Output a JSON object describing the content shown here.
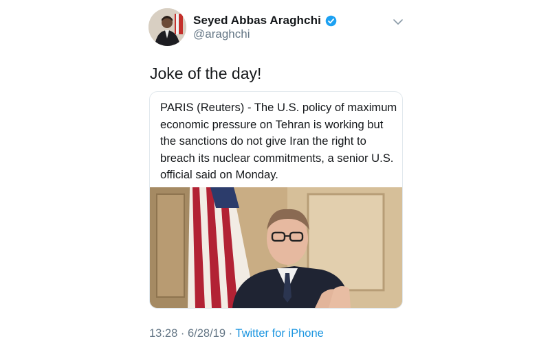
{
  "author": {
    "name": "Seyed Abbas Araghchi",
    "handle": "@araghchi",
    "verified_icon": "verified-badge-icon",
    "avatar_icon": "avatar"
  },
  "tweet": {
    "text": "Joke of the day!"
  },
  "card": {
    "text": "PARIS (Reuters) - The U.S. policy of maximum economic pressure on Tehran is working but the sanctions do not give Iran the right to breach its nuclear commitments, a senior U.S. official said on Monday."
  },
  "meta": {
    "time": "13:28",
    "separator1": " · ",
    "date": "6/28/19",
    "separator2": " · ",
    "source": "Twitter for iPhone"
  },
  "colors": {
    "accent": "#1da1f2",
    "link": "#1b95e0",
    "secondary_text": "#657786"
  }
}
